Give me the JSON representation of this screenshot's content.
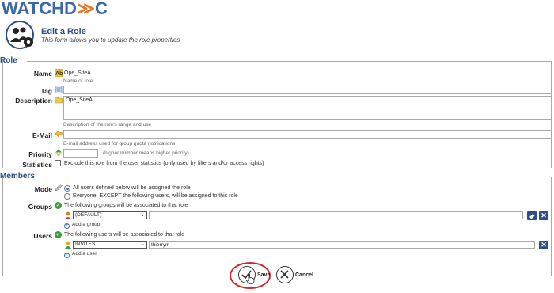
{
  "brand": {
    "logo_text_left": "WATCHD",
    "logo_text_right": "C"
  },
  "header": {
    "title": "Edit a Role",
    "subtitle": "This form allows you to update the role properties"
  },
  "sections": {
    "role": "Role",
    "members": "Members"
  },
  "fields": {
    "name": {
      "label": "Name",
      "value": "Ope_SiteA",
      "hint": "Name of role"
    },
    "tag": {
      "label": "Tag",
      "value": ""
    },
    "description": {
      "label": "Description",
      "value": "Ope_SiteA",
      "hint": "Description of the role's range and use"
    },
    "email": {
      "label": "E-Mail",
      "value": "",
      "hint": "E-mail address used for group quota notifications"
    },
    "priority": {
      "label": "Priority",
      "value": "",
      "hint": "(higher number means higher priority)"
    },
    "statistics": {
      "label": "Statistics",
      "checked": false,
      "text": "Exclude this role from the user statistics (only used by filters and/or access rights)"
    }
  },
  "members": {
    "mode": {
      "label": "Mode",
      "options": [
        {
          "text": "All users defined below will be assigned the role",
          "selected": true
        },
        {
          "text": "Everyone, EXCEPT the following users, will be assigned to this role",
          "selected": false
        }
      ]
    },
    "groups": {
      "label": "Groups",
      "text": "The following groups will be associated to that role",
      "rows": [
        {
          "select": "(DEFAULT)",
          "value": ""
        }
      ],
      "add": "Add a group"
    },
    "users": {
      "label": "Users",
      "text": "The following users will be associated to that role",
      "rows": [
        {
          "select": "INVITES",
          "value": "thierrym"
        }
      ],
      "add": "Add a user"
    }
  },
  "actions": {
    "save": "Save",
    "cancel": "Cancel"
  },
  "icons": {
    "x": "✕",
    "check": "✓",
    "plus": "+",
    "caret": "⌄"
  },
  "colors": {
    "accent": "#2a4e86",
    "brand_orange": "#e8742a",
    "highlight": "#d6262a",
    "ok": "#3aa035"
  }
}
